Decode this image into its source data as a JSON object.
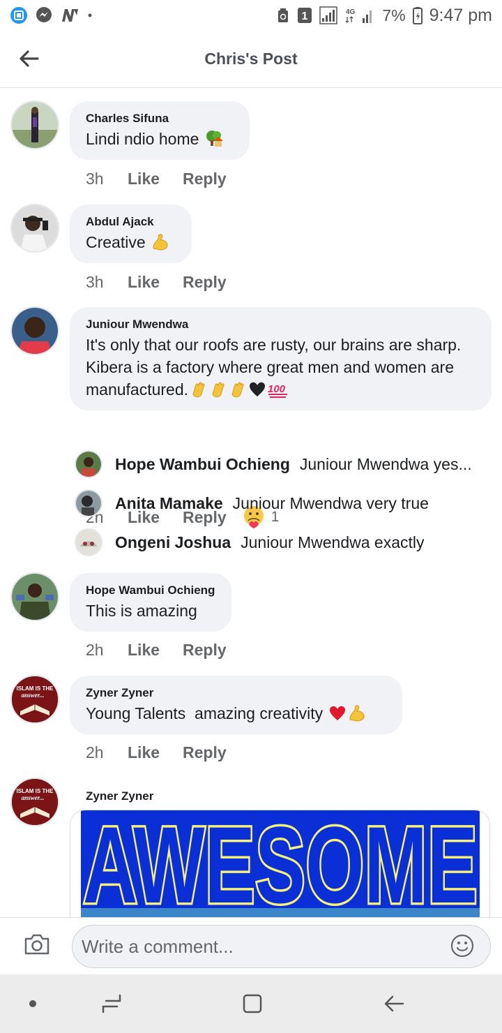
{
  "status_bar": {
    "battery": "7%",
    "time": "9:47 pm",
    "network": "4G",
    "notification_count": "1"
  },
  "header": {
    "title": "Chris's Post"
  },
  "comments": [
    {
      "name": "Charles Sifuna",
      "text": "Lindi ndio home",
      "emoji": [
        "tree-house"
      ],
      "time": "3h",
      "like": "Like",
      "reply": "Reply"
    },
    {
      "name": "Abdul Ajack",
      "text": "Creative",
      "emoji": [
        "flexed-biceps"
      ],
      "time": "3h",
      "like": "Like",
      "reply": "Reply"
    },
    {
      "name": "Juniour Mwendwa",
      "text_lines": [
        "It's only that our roofs are rusty, our brains are sharp.",
        "Kibera is a factory where great men and women are",
        "manufactured."
      ],
      "emoji": [
        "clapping-hands",
        "clapping-hands",
        "clapping-hands",
        "black-heart",
        "hundred-points"
      ],
      "time": "2h",
      "like": "Like",
      "reply": "Reply",
      "reaction": "care",
      "reaction_count": "1"
    },
    {
      "name": "Hope Wambui Ochieng",
      "text": "This is amazing",
      "time": "2h",
      "like": "Like",
      "reply": "Reply"
    },
    {
      "name": "Zyner Zyner",
      "text": "Young Talents  amazing creativity",
      "emoji": [
        "red-heart",
        "flexed-biceps"
      ],
      "time": "2h",
      "like": "Like",
      "reply": "Reply"
    },
    {
      "name": "Zyner Zyner",
      "image_text": "AWESOME"
    }
  ],
  "replies": [
    {
      "name": "Hope Wambui Ochieng",
      "text": "Juniour Mwendwa yes..."
    },
    {
      "name": "Anita Mamake",
      "text": "Juniour Mwendwa very true"
    },
    {
      "name": "Ongeni Joshua",
      "text": "Juniour Mwendwa exactly"
    }
  ],
  "composer": {
    "placeholder": "Write a comment..."
  },
  "avatar_badge_text": [
    "ISLAM IS THE",
    "answer..."
  ],
  "colors": {
    "accent": "#1877f2",
    "bubble": "#f0f2f5",
    "meta_text": "#65676b",
    "awesome_blue": "#0a2fd6",
    "awesome_outline": "#f5f07a",
    "awesome_bg": "#3a86c8"
  }
}
